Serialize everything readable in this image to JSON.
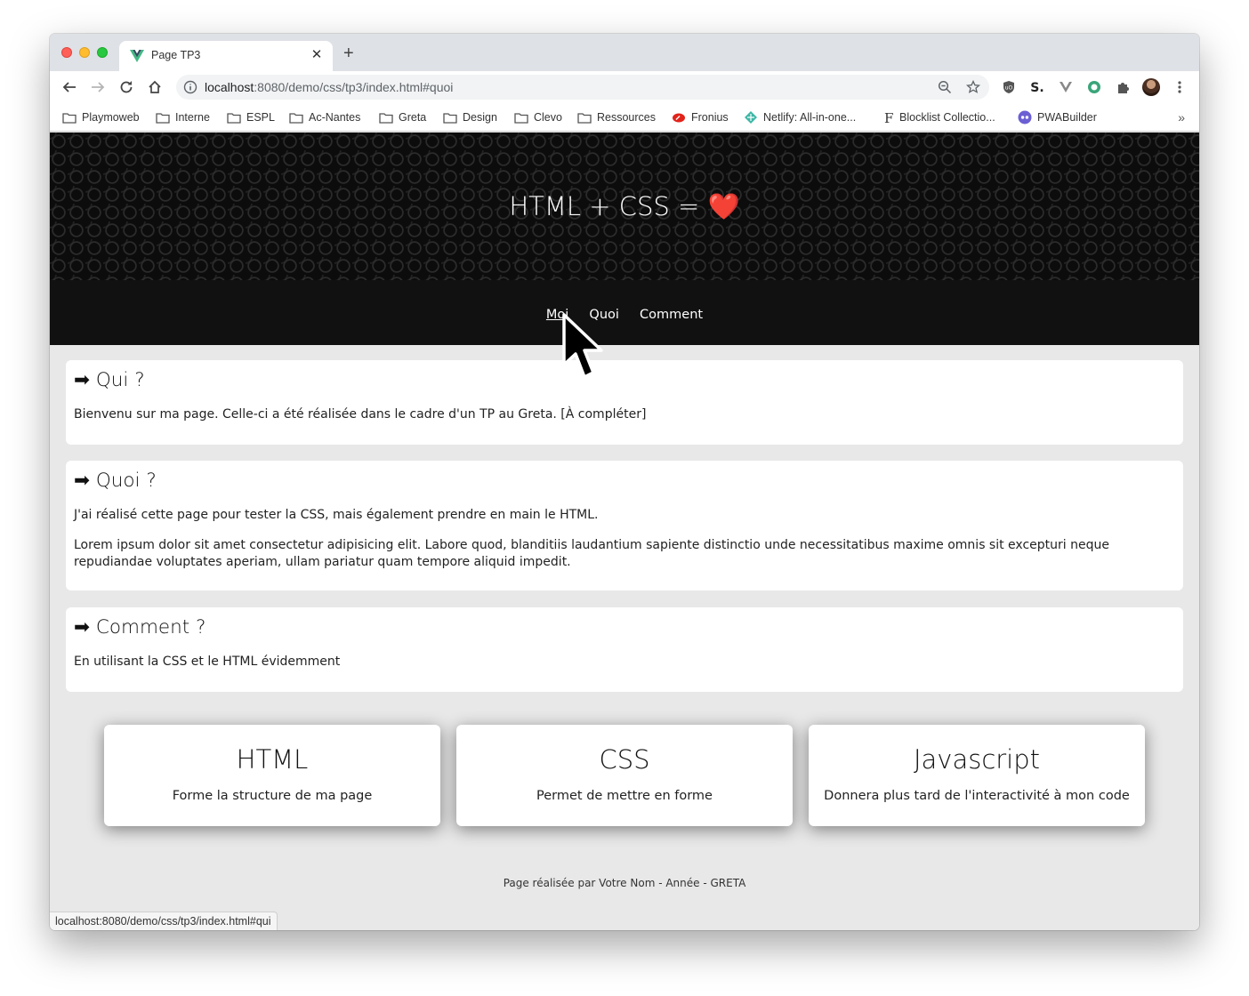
{
  "browser": {
    "tab": {
      "title": "Page TP3",
      "favicon": "vue-logo-icon",
      "close_icon": "✕"
    },
    "new_tab_icon": "+",
    "address": {
      "host": "localhost",
      "path": ":8080/demo/css/tp3/index.html#quoi"
    },
    "bookmarks": [
      {
        "label": "Playmoweb",
        "icon": "folder-icon"
      },
      {
        "label": "Interne",
        "icon": "folder-icon"
      },
      {
        "label": "ESPL",
        "icon": "folder-icon"
      },
      {
        "label": "Ac-Nantes",
        "icon": "folder-icon"
      },
      {
        "label": "Greta",
        "icon": "folder-icon"
      },
      {
        "label": "Design",
        "icon": "folder-icon"
      },
      {
        "label": "Clevo",
        "icon": "folder-icon"
      },
      {
        "label": "Ressources",
        "icon": "folder-icon"
      },
      {
        "label": "Fronius",
        "icon": "fronius-icon"
      },
      {
        "label": "Netlify: All-in-one...",
        "icon": "netlify-icon"
      },
      {
        "label": "Blocklist Collectio...",
        "icon": "f-letter-icon"
      },
      {
        "label": "PWABuilder",
        "icon": "pwabuilder-icon"
      }
    ],
    "bookmarks_more": "»",
    "status_url": "localhost:8080/demo/css/tp3/index.html#qui"
  },
  "page": {
    "hero_title": "HTML + CSS = ",
    "hero_heart": "❤️",
    "nav": [
      {
        "label": "Moi",
        "active": true
      },
      {
        "label": "Quoi",
        "active": false
      },
      {
        "label": "Comment",
        "active": false
      }
    ],
    "sections": [
      {
        "title": "➡ Qui ?",
        "paragraphs": [
          "Bienvenu sur ma page. Celle-ci a été réalisée dans le cadre d'un TP au Greta. [À compléter]"
        ]
      },
      {
        "title": "➡ Quoi ?",
        "paragraphs": [
          "J'ai réalisé cette page pour tester la CSS, mais également prendre en main le HTML.",
          "Lorem ipsum dolor sit amet consectetur adipisicing elit. Labore quod, blanditiis laudantium sapiente distinctio unde necessitatibus maxime omnis sit excepturi neque repudiandae voluptates aperiam, ullam pariatur quam tempore aliquid impedit."
        ]
      },
      {
        "title": "➡ Comment ?",
        "paragraphs": [
          "En utilisant la CSS et le HTML évidemment"
        ]
      }
    ],
    "features": [
      {
        "title": "HTML",
        "text": "Forme la structure de ma page"
      },
      {
        "title": "CSS",
        "text": "Permet de mettre en forme"
      },
      {
        "title": "Javascript",
        "text": "Donnera plus tard de l'interactivité à mon code"
      }
    ],
    "footer": "Page réalisée par Votre Nom - Année - GRETA"
  }
}
